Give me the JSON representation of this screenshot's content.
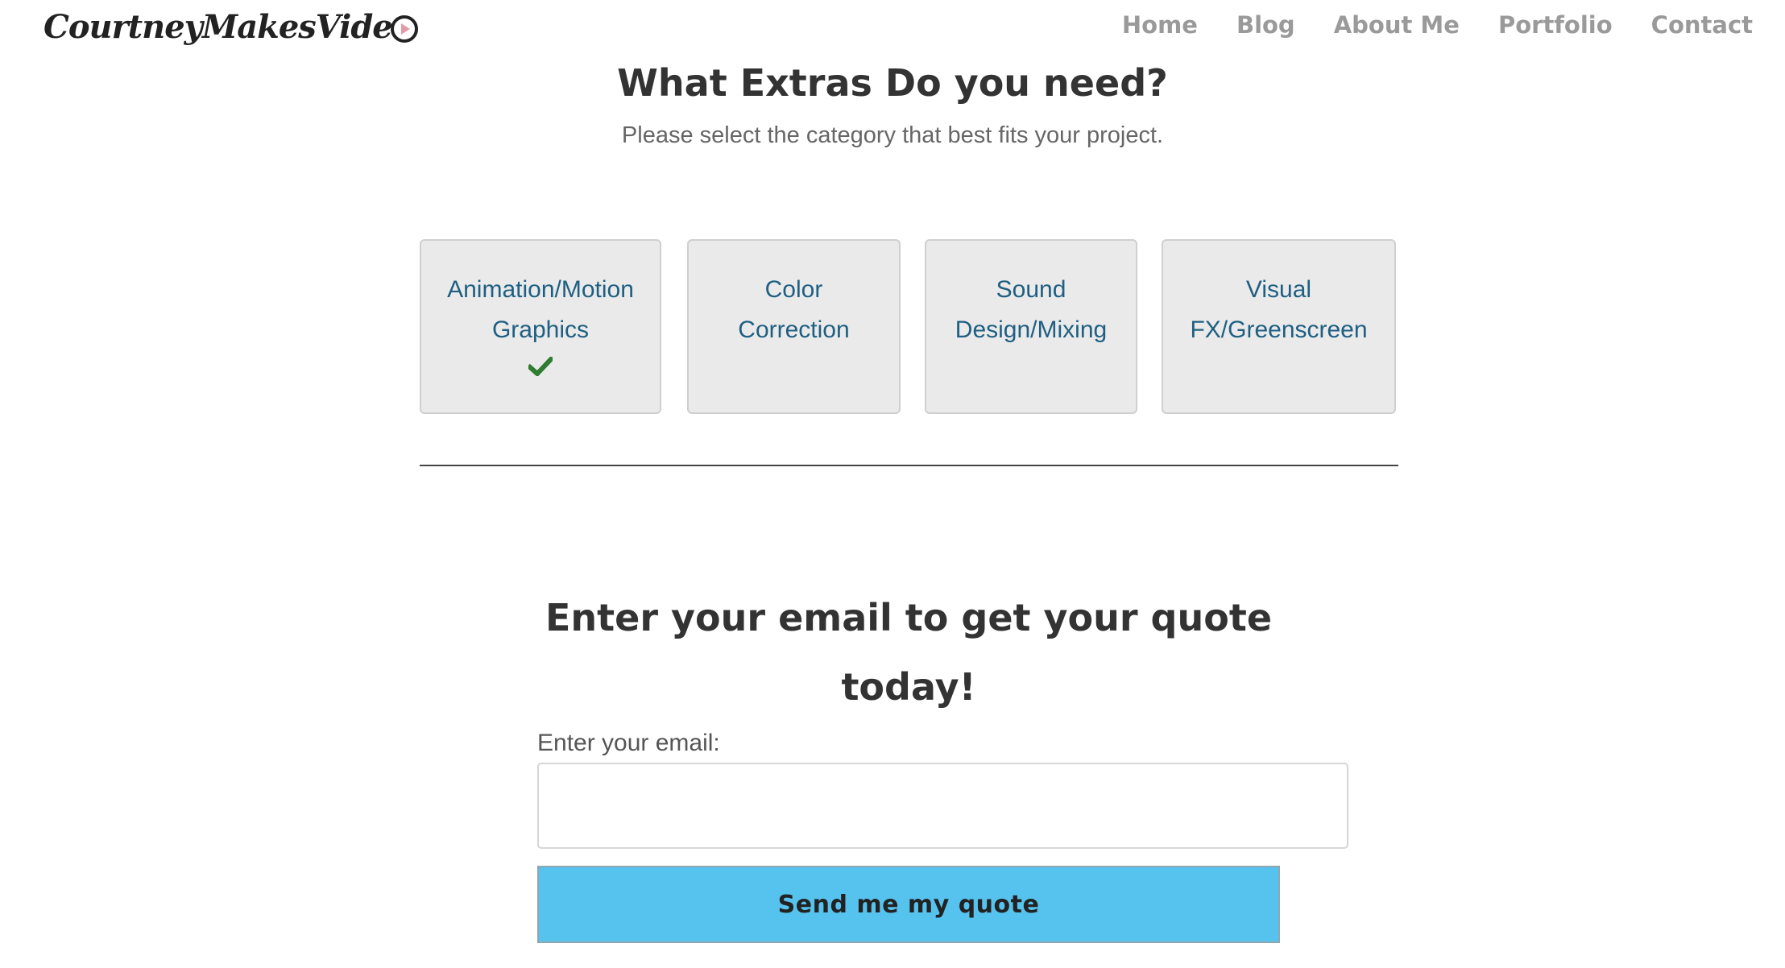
{
  "header": {
    "logo_text": "CourtneyMakesVide",
    "nav": [
      {
        "label": "Home"
      },
      {
        "label": "Blog"
      },
      {
        "label": "About Me"
      },
      {
        "label": "Portfolio"
      },
      {
        "label": "Contact"
      }
    ]
  },
  "section": {
    "title": "What Extras Do you need?",
    "subtitle": "Please select the category that best fits your project."
  },
  "categories": [
    {
      "line1": "Animation/Motion",
      "line2": "Graphics",
      "selected": true
    },
    {
      "line1": "Color",
      "line2": "Correction",
      "selected": false
    },
    {
      "line1": "Sound",
      "line2": "Design/Mixing",
      "selected": false
    },
    {
      "line1": "Visual",
      "line2": "FX/Greenscreen",
      "selected": false
    }
  ],
  "quote": {
    "heading_line1": "Enter your email to get your quote",
    "heading_line2": "today!",
    "email_label": "Enter your email:",
    "email_value": "",
    "button_label": "Send me my quote"
  },
  "colors": {
    "card_bg": "#eaeaea",
    "card_text": "#1f5f82",
    "check": "#2e7d32",
    "button_bg": "#56c3ee",
    "nav_text": "#9a9a9a"
  },
  "icons": {
    "selected_marker": "checkmark-icon",
    "logo_mark": "play-circle-icon"
  }
}
